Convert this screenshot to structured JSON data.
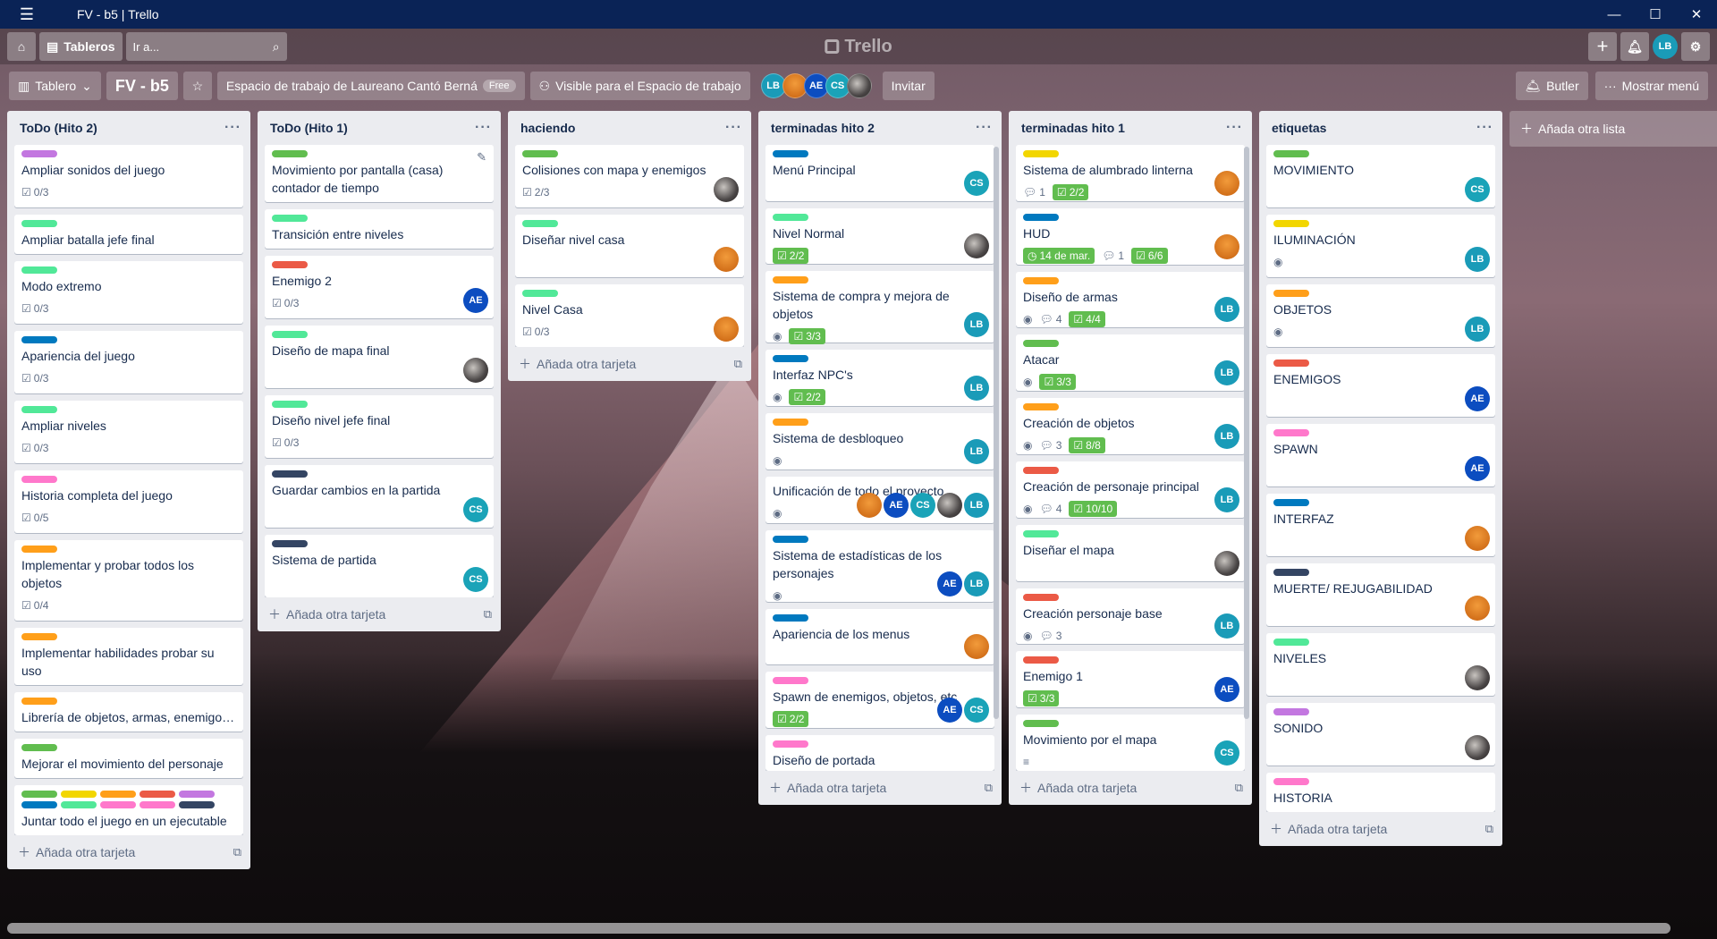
{
  "window": {
    "title": "FV - b5 | Trello"
  },
  "header": {
    "boards_label": "Tableros",
    "search_placeholder": "Ir a...",
    "logo": "Trello",
    "user_initials": "LB"
  },
  "board": {
    "view_label": "Tablero",
    "name": "FV - b5",
    "workspace": "Espacio de trabajo de Laureano Cantó Berná",
    "workspace_badge": "Free",
    "visibility": "Visible para el Espacio de trabajo",
    "invite": "Invitar",
    "butler": "Butler",
    "menu": "Mostrar menú",
    "members": [
      "LB",
      "",
      "AE",
      "CS",
      ""
    ]
  },
  "colors": {
    "green": "#61bd4f",
    "yellow": "#f2d600",
    "orange": "#ff9f1a",
    "red": "#eb5a46",
    "purple": "#c377e0",
    "blue": "#0079bf",
    "lime": "#51e898",
    "pink": "#ff78cb",
    "black": "#344563"
  },
  "add_card_label": "Añada otra tarjeta",
  "add_list_label": "Añada otra lista",
  "lists": [
    {
      "title": "ToDo (Hito 2)",
      "cards": [
        {
          "title": "Ampliar sonidos del juego",
          "labels": [
            "purple"
          ],
          "check": "0/3"
        },
        {
          "title": "Ampliar batalla jefe final",
          "labels": [
            "lime"
          ]
        },
        {
          "title": "Modo extremo",
          "labels": [
            "lime"
          ],
          "check": "0/3"
        },
        {
          "title": "Apariencia del juego",
          "labels": [
            "blue"
          ],
          "check": "0/3"
        },
        {
          "title": "Ampliar niveles",
          "labels": [
            "lime"
          ],
          "check": "0/3"
        },
        {
          "title": "Historia completa del juego",
          "labels": [
            "pink"
          ],
          "check": "0/5"
        },
        {
          "title": "Implementar y probar todos los objetos",
          "labels": [
            "orange"
          ],
          "check": "0/4"
        },
        {
          "title": "Implementar habilidades probar su uso",
          "labels": [
            "orange"
          ]
        },
        {
          "title": "Librería de objetos, armas, enemigos...",
          "labels": [
            "orange"
          ],
          "trunc": true
        },
        {
          "title": "Mejorar el movimiento del personaje",
          "labels": [
            "green"
          ]
        },
        {
          "title": "Juntar todo el juego en un ejecutable",
          "labels": [
            "green",
            "yellow",
            "orange",
            "red",
            "purple",
            "blue",
            "lime",
            "pink",
            "pink",
            "black"
          ]
        }
      ]
    },
    {
      "title": "ToDo (Hito 1)",
      "cards": [
        {
          "title": "Movimiento por pantalla (casa) contador de tiempo",
          "labels": [
            "green"
          ],
          "edit": true
        },
        {
          "title": "Transición entre niveles",
          "labels": [
            "lime"
          ]
        },
        {
          "title": "Enemigo 2",
          "labels": [
            "red"
          ],
          "check": "0/3",
          "members": [
            "AE"
          ]
        },
        {
          "title": "Diseño de mapa final",
          "labels": [
            "lime"
          ],
          "members": [
            "PH"
          ]
        },
        {
          "title": "Diseño nivel jefe final",
          "labels": [
            "lime"
          ],
          "check": "0/3"
        },
        {
          "title": "Guardar cambios en la partida",
          "labels": [
            "black"
          ],
          "members": [
            "CS"
          ]
        },
        {
          "title": "Sistema de partida",
          "labels": [
            "black"
          ],
          "members": [
            "CS"
          ]
        }
      ]
    },
    {
      "title": "haciendo",
      "cards": [
        {
          "title": "Colisiones con mapa y enemigos",
          "labels": [
            "green"
          ],
          "check": "2/3",
          "members": [
            "PH"
          ]
        },
        {
          "title": "Diseñar nivel casa",
          "labels": [
            "lime"
          ],
          "members": [
            "OR"
          ]
        },
        {
          "title": "Nivel Casa",
          "labels": [
            "lime"
          ],
          "check": "0/3",
          "members": [
            "OR"
          ]
        }
      ]
    },
    {
      "title": "terminadas hito 2",
      "scroll": true,
      "cards": [
        {
          "title": "Menú Principal",
          "labels": [
            "blue"
          ],
          "members": [
            "CS"
          ]
        },
        {
          "title": "Nivel Normal",
          "labels": [
            "lime"
          ],
          "checkDone": "2/2",
          "members": [
            "PH"
          ]
        },
        {
          "title": "Sistema de compra y mejora de objetos",
          "labels": [
            "orange"
          ],
          "eye": true,
          "checkDone": "3/3",
          "members": [
            "LB"
          ]
        },
        {
          "title": "Interfaz NPC's",
          "labels": [
            "blue"
          ],
          "eye": true,
          "checkDone": "2/2",
          "members": [
            "LB"
          ]
        },
        {
          "title": "Sistema de desbloqueo",
          "labels": [
            "orange"
          ],
          "eye": true,
          "members": [
            "LB"
          ]
        },
        {
          "title": "Unificación de todo el proyecto",
          "labels": [],
          "eye": true,
          "members": [
            "OR",
            "AE",
            "CS",
            "PH",
            "LB"
          ]
        },
        {
          "title": "Sistema de estadísticas de los personajes",
          "labels": [
            "blue"
          ],
          "eye": true,
          "members": [
            "AE",
            "LB"
          ]
        },
        {
          "title": "Apariencia de los menus",
          "labels": [
            "blue"
          ],
          "members": [
            "OR"
          ]
        },
        {
          "title": "Spawn de enemigos, objetos, etc",
          "labels": [
            "pink"
          ],
          "checkDone": "2/2",
          "members": [
            "AE",
            "CS"
          ]
        },
        {
          "title": "Diseño de portada",
          "labels": [
            "pink"
          ]
        }
      ]
    },
    {
      "title": "terminadas hito 1",
      "scroll": true,
      "cards": [
        {
          "title": "Sistema de alumbrado linterna",
          "labels": [
            "yellow"
          ],
          "comments": "1",
          "checkDone": "2/2",
          "members": [
            "OR"
          ]
        },
        {
          "title": "HUD",
          "labels": [
            "blue"
          ],
          "date": "14 de mar.",
          "comments": "1",
          "checkDone": "6/6",
          "members": [
            "OR"
          ]
        },
        {
          "title": "Diseño de armas",
          "labels": [
            "orange"
          ],
          "eye": true,
          "comments": "4",
          "checkDone": "4/4",
          "members": [
            "LB"
          ]
        },
        {
          "title": "Atacar",
          "labels": [
            "green"
          ],
          "eye": true,
          "checkDone": "3/3",
          "members": [
            "LB"
          ]
        },
        {
          "title": "Creación de objetos",
          "labels": [
            "orange"
          ],
          "eye": true,
          "comments": "3",
          "checkDone": "8/8",
          "members": [
            "LB"
          ]
        },
        {
          "title": "Creación de personaje principal",
          "labels": [
            "red"
          ],
          "eye": true,
          "comments": "4",
          "checkDone": "10/10",
          "members": [
            "LB"
          ]
        },
        {
          "title": "Diseñar el mapa",
          "labels": [
            "lime"
          ],
          "members": [
            "PH"
          ]
        },
        {
          "title": "Creación personaje base",
          "labels": [
            "red"
          ],
          "eye": true,
          "comments": "3",
          "members": [
            "LB"
          ]
        },
        {
          "title": "Enemigo 1",
          "labels": [
            "red"
          ],
          "checkDone": "3/3",
          "members": [
            "AE"
          ]
        },
        {
          "title": "Movimiento por el mapa",
          "labels": [
            "green"
          ],
          "desc": true,
          "members": [
            "CS"
          ]
        }
      ]
    },
    {
      "title": "etiquetas",
      "cards": [
        {
          "title": "MOVIMIENTO",
          "labels": [
            "green"
          ],
          "members": [
            "CS"
          ]
        },
        {
          "title": "ILUMINACIÓN",
          "labels": [
            "yellow"
          ],
          "eye": true,
          "members": [
            "LB"
          ]
        },
        {
          "title": "OBJETOS",
          "labels": [
            "orange"
          ],
          "eye": true,
          "members": [
            "LB"
          ]
        },
        {
          "title": "ENEMIGOS",
          "labels": [
            "red"
          ],
          "members": [
            "AE"
          ]
        },
        {
          "title": "SPAWN",
          "labels": [
            "pink"
          ],
          "members": [
            "AE"
          ]
        },
        {
          "title": "INTERFAZ",
          "labels": [
            "blue"
          ],
          "members": [
            "OR"
          ]
        },
        {
          "title": "MUERTE/ REJUGABILIDAD",
          "labels": [
            "black"
          ],
          "members": [
            "OR"
          ]
        },
        {
          "title": "NIVELES",
          "labels": [
            "lime"
          ],
          "members": [
            "PH"
          ]
        },
        {
          "title": "SONIDO",
          "labels": [
            "purple"
          ],
          "members": [
            "PH"
          ]
        },
        {
          "title": "HISTORIA",
          "labels": [
            "pink"
          ]
        }
      ]
    }
  ]
}
